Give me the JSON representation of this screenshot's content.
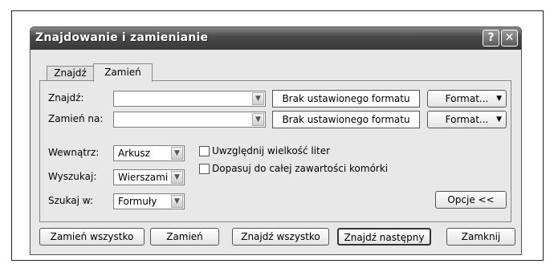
{
  "dialog": {
    "title": "Znajdowanie i zamienianie",
    "help_label": "?",
    "close_label": "✕"
  },
  "tabs": [
    {
      "label": "Znajdź",
      "selected": false
    },
    {
      "label": "Zamień",
      "selected": true
    }
  ],
  "find": {
    "label": "Znajdź:",
    "value": "",
    "format_preview": "Brak ustawionego formatu",
    "format_button": "Format..."
  },
  "replace": {
    "label": "Zamień na:",
    "value": "",
    "format_preview": "Brak ustawionego formatu",
    "format_button": "Format..."
  },
  "within": {
    "label": "Wewnątrz:",
    "value": "Arkusz"
  },
  "search": {
    "label": "Wyszukaj:",
    "value": "Wierszami"
  },
  "look_in": {
    "label": "Szukaj w:",
    "value": "Formuły"
  },
  "options": {
    "match_case": {
      "label": "Uwzględnij wielkość liter",
      "checked": false
    },
    "entire_cell": {
      "label": "Dopasuj do całej zawartości komórki",
      "checked": false
    }
  },
  "options_button": "Opcje <<",
  "footer": {
    "replace_all": "Zamień wszystko",
    "replace": "Zamień",
    "find_all": "Znajdź wszystko",
    "find_next": "Znajdź następny",
    "close": "Zamknij"
  }
}
